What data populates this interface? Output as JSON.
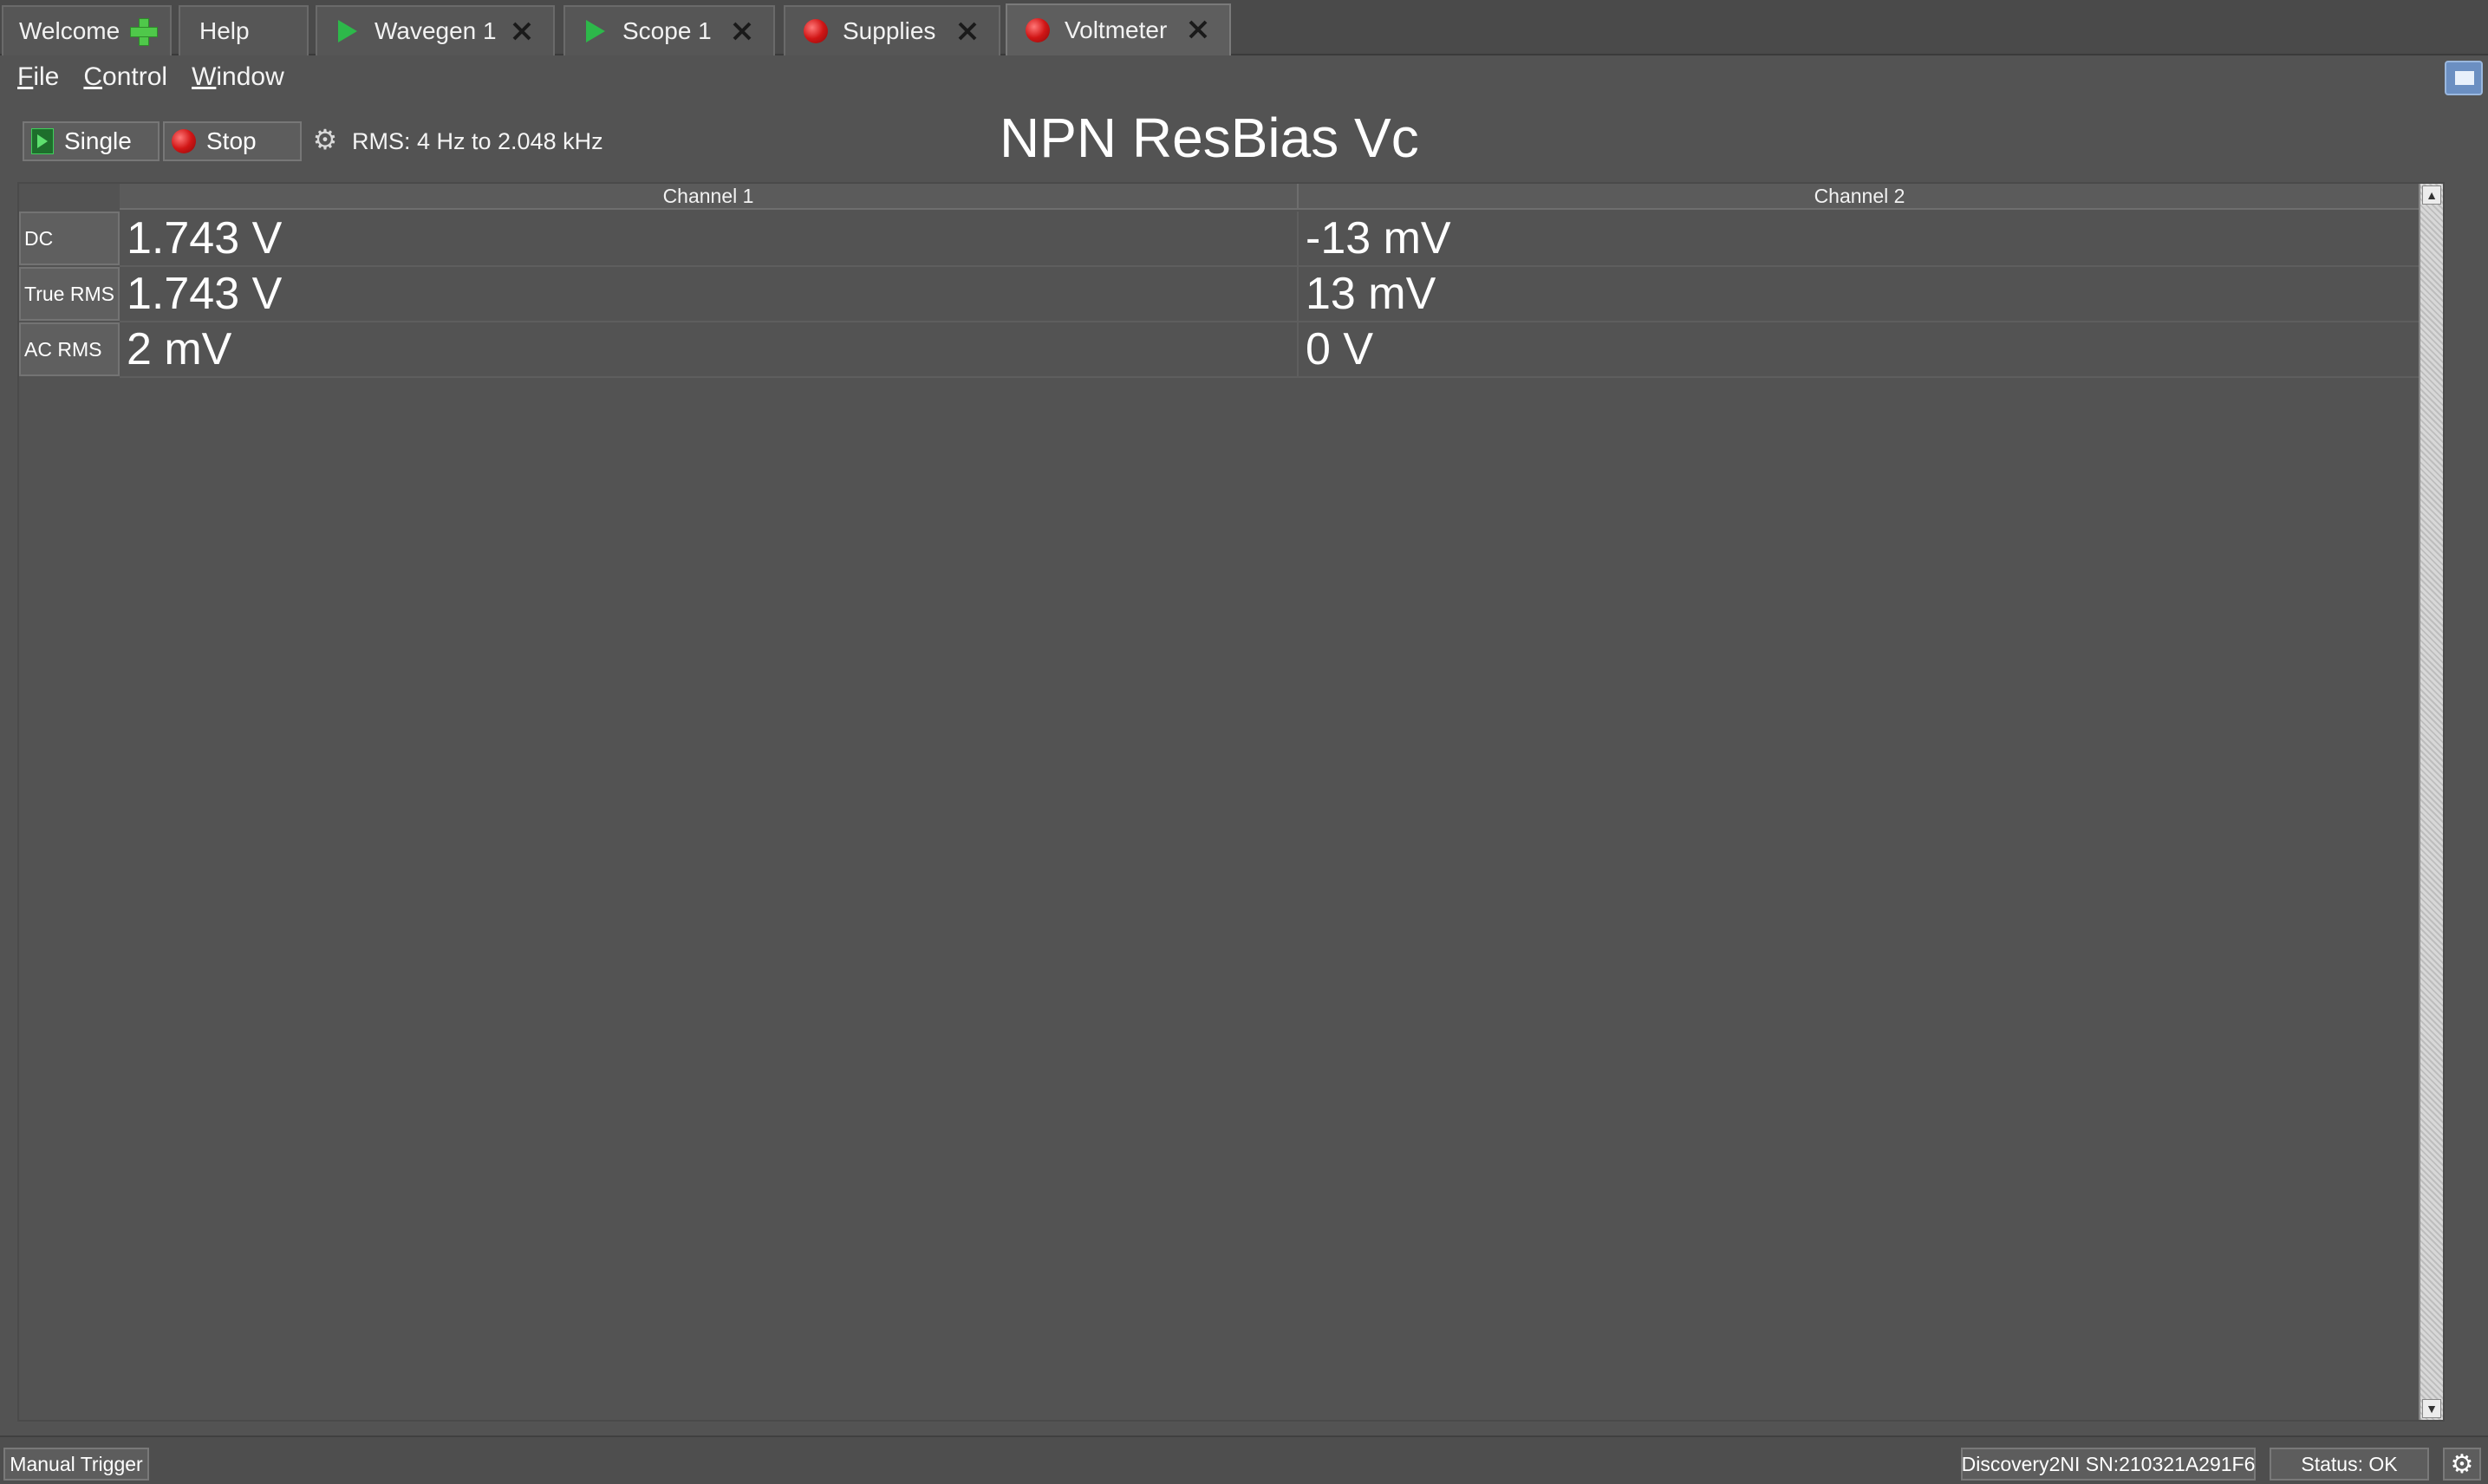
{
  "tabs": [
    {
      "label": "Welcome",
      "icon": "plus-icon",
      "closable": false
    },
    {
      "label": "Help",
      "icon": null,
      "closable": false
    },
    {
      "label": "Wavegen 1",
      "icon": "run-icon",
      "closable": true
    },
    {
      "label": "Scope 1",
      "icon": "run-icon",
      "closable": true
    },
    {
      "label": "Supplies",
      "icon": "stop-icon",
      "closable": true
    },
    {
      "label": "Voltmeter",
      "icon": "stop-icon",
      "closable": true,
      "active": true
    }
  ],
  "menu": {
    "file": {
      "underline": "F",
      "rest": "ile"
    },
    "control": {
      "underline": "C",
      "rest": "ontrol"
    },
    "window": {
      "underline": "W",
      "rest": "indow"
    }
  },
  "toolbar": {
    "single_label": "Single",
    "stop_label": "Stop",
    "rms_info": "RMS: 4 Hz to 2.048 kHz"
  },
  "instrument_title": "NPN ResBias Vc",
  "table": {
    "columns": [
      "Channel 1",
      "Channel 2"
    ],
    "rows": [
      {
        "label": "DC",
        "values": [
          "1.743 V",
          "-13 mV"
        ]
      },
      {
        "label": "True RMS",
        "values": [
          "1.743 V",
          "13 mV"
        ]
      },
      {
        "label": "AC RMS",
        "values": [
          "2 mV",
          "0 V"
        ]
      }
    ]
  },
  "status": {
    "trigger_label": "Manual Trigger",
    "device": "Discovery2NI SN:210321A291F6",
    "status_text": "Status: OK"
  },
  "colors": {
    "background": "#535353",
    "run_green": "#2db84a",
    "stop_red": "#d11616"
  }
}
